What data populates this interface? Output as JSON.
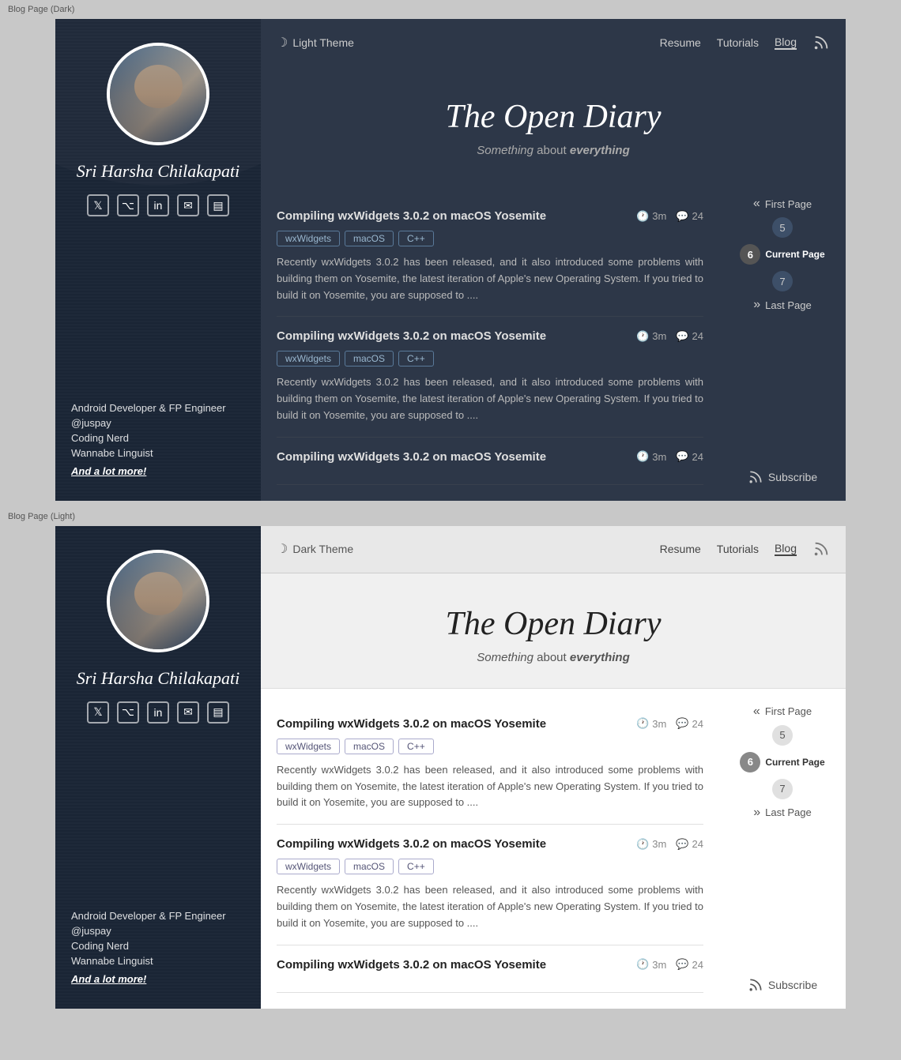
{
  "dark_section": {
    "label": "Blog Page (Dark)",
    "sidebar": {
      "name": "Sri Harsha Chilakapati",
      "bio_lines": [
        "Android Developer & FP Engineer",
        "@juspay",
        "Coding Nerd",
        "Wannabe Linguist"
      ],
      "more_text": "And a lot ",
      "more_link": "more!"
    },
    "navbar": {
      "theme_toggle": "Light Theme",
      "nav_links": [
        "Resume",
        "Tutorials",
        "Blog"
      ]
    },
    "hero": {
      "title": "The Open Diary",
      "subtitle_something": "Something",
      "subtitle_rest": " about ",
      "subtitle_everything": "everything"
    },
    "posts": [
      {
        "title": "Compiling wxWidgets 3.0.2 on macOS Yosemite",
        "time": "3m",
        "comments": "24",
        "tags": [
          "wxWidgets",
          "macOS",
          "C++"
        ],
        "excerpt": "Recently wxWidgets 3.0.2 has been released, and it also introduced some problems with building them on Yosemite, the latest iteration of Apple's new Operating System. If you tried to build it on Yosemite, you are supposed to ...."
      },
      {
        "title": "Compiling wxWidgets 3.0.2 on macOS Yosemite",
        "time": "3m",
        "comments": "24",
        "tags": [
          "wxWidgets",
          "macOS",
          "C++"
        ],
        "excerpt": "Recently wxWidgets 3.0.2 has been released, and it also introduced some problems with building them on Yosemite, the latest iteration of Apple's new Operating System. If you tried to build it on Yosemite, you are supposed to ...."
      },
      {
        "title": "Compiling wxWidgets 3.0.2 on macOS Yosemite",
        "time": "3m",
        "comments": "24",
        "tags": [],
        "excerpt": ""
      }
    ],
    "pagination": {
      "first_page": "First Page",
      "pages": [
        "5",
        "6",
        "7"
      ],
      "current_page": "6",
      "current_page_label": "Current Page",
      "last_page": "Last Page"
    },
    "subscribe": "Subscribe"
  },
  "light_section": {
    "label": "Blog Page (Light)",
    "sidebar": {
      "name": "Sri Harsha Chilakapati",
      "bio_lines": [
        "Android Developer & FP Engineer",
        "@juspay",
        "Coding Nerd",
        "Wannabe Linguist"
      ],
      "more_text": "And a lot ",
      "more_link": "more!"
    },
    "navbar": {
      "theme_toggle": "Dark Theme",
      "nav_links": [
        "Resume",
        "Tutorials",
        "Blog"
      ]
    },
    "hero": {
      "title": "The Open Diary",
      "subtitle_something": "Something",
      "subtitle_rest": " about ",
      "subtitle_everything": "everything"
    },
    "posts": [
      {
        "title": "Compiling wxWidgets 3.0.2 on macOS Yosemite",
        "time": "3m",
        "comments": "24",
        "tags": [
          "wxWidgets",
          "macOS",
          "C++"
        ],
        "excerpt": "Recently wxWidgets 3.0.2 has been released, and it also introduced some problems with building them on Yosemite, the latest iteration of Apple's new Operating System. If you tried to build it on Yosemite, you are supposed to ...."
      },
      {
        "title": "Compiling wxWidgets 3.0.2 on macOS Yosemite",
        "time": "3m",
        "comments": "24",
        "tags": [
          "wxWidgets",
          "macOS",
          "C++"
        ],
        "excerpt": "Recently wxWidgets 3.0.2 has been released, and it also introduced some problems with building them on Yosemite, the latest iteration of Apple's new Operating System. If you tried to build it on Yosemite, you are supposed to ...."
      },
      {
        "title": "Compiling wxWidgets 3.0.2 on macOS Yosemite",
        "time": "3m",
        "comments": "24",
        "tags": [],
        "excerpt": ""
      }
    ],
    "pagination": {
      "first_page": "First Page",
      "pages": [
        "5",
        "6",
        "7"
      ],
      "current_page": "6",
      "current_page_label": "Current Page",
      "last_page": "Last Page"
    },
    "subscribe": "Subscribe"
  }
}
